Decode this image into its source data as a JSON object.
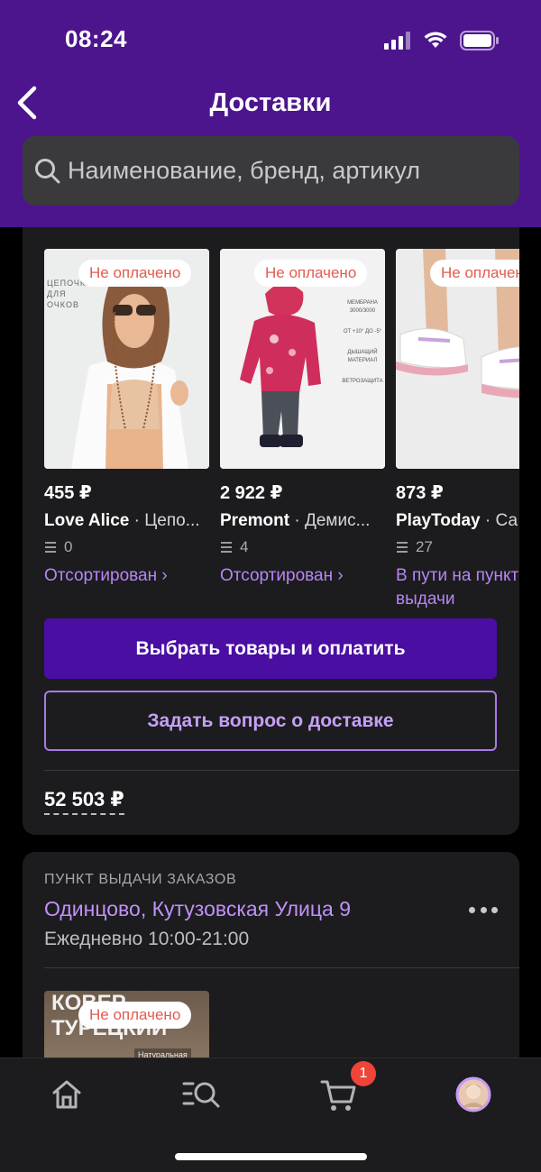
{
  "status_bar": {
    "time": "08:24"
  },
  "header": {
    "title": "Доставки"
  },
  "search": {
    "placeholder": "Наименование, бренд, артикул"
  },
  "delivery": {
    "products": [
      {
        "badge": "Не оплачено",
        "price": "455 ₽",
        "brand": "Love Alice",
        "desc": " · Цепо...",
        "qty": "0",
        "status": "Отсортирован ›"
      },
      {
        "badge": "Не оплачено",
        "price": "2 922 ₽",
        "brand": "Premont",
        "desc": " · Демис...",
        "qty": "4",
        "status": "Отсортирован ›"
      },
      {
        "badge": "Не оплачено",
        "price": "873 ₽",
        "brand": "PlayToday",
        "desc": " · Са",
        "qty": "27",
        "status": "В пути на пункт выдачи"
      }
    ],
    "product_image_text": {
      "p1": "ЦЕПОЧКА ДЛЯ ОЧКОВ",
      "p2": [
        "МЕМБРАНА 3000/3000",
        "ОТ +10° ДО -5°",
        "ДЫШАЩИЙ МАТЕРИАЛ",
        "ВЕТРОЗАЩИТА"
      ]
    },
    "pay_button": "Выбрать товары и оплатить",
    "question_button": "Задать вопрос о доставке",
    "total": "52 503 ₽"
  },
  "pickup": {
    "label": "ПУНКТ ВЫДАЧИ ЗАКАЗОВ",
    "address": "Одинцово, Кутузовская Улица 9",
    "hours": "Ежедневно 10:00-21:00",
    "item": {
      "badge": "Не оплачено",
      "line1": "КОВЕР",
      "line2": "ТУРЕЦКИЙ",
      "tag": "Натуральная"
    }
  },
  "tabbar": {
    "cart_count": "1"
  },
  "colors": {
    "header": "#4c158e",
    "accent": "#b786f5",
    "primary_button": "#4a0ea3",
    "badge_text": "#e55a4e",
    "cart_badge": "#f04438"
  }
}
